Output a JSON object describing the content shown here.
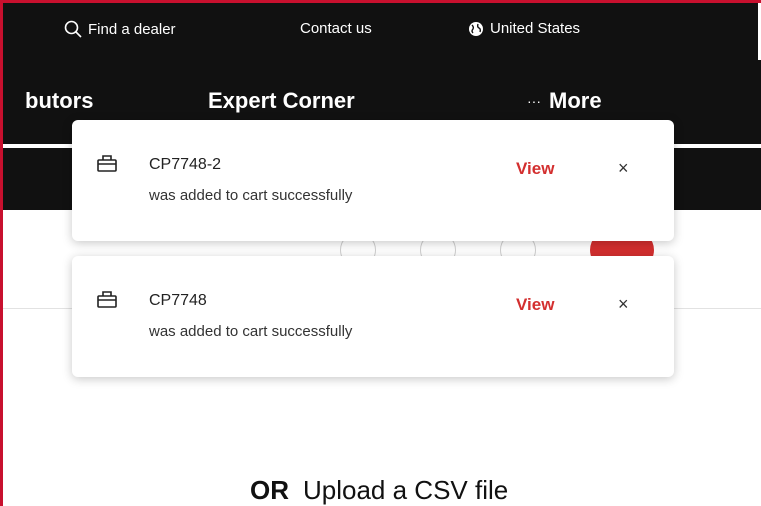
{
  "header": {
    "utility_links": {
      "find_dealer": "Find a dealer",
      "contact_us": "Contact us",
      "region": "United States"
    },
    "nav": {
      "distributors_partial": "butors",
      "expert_corner": "Expert Corner",
      "more_prefix": "···",
      "more": "More"
    }
  },
  "toasts": [
    {
      "sku": "CP7748-2",
      "message": "was added to cart successfully",
      "action": "View",
      "close": "×"
    },
    {
      "sku": "CP7748",
      "message": "was added to cart successfully",
      "action": "View",
      "close": "×"
    }
  ],
  "main": {
    "upload_or": "OR",
    "upload_label": "Upload a CSV file"
  },
  "colors": {
    "accent": "#d32f2f",
    "header_bg": "#111111",
    "frame": "#c8102e"
  },
  "icons": [
    "search-icon",
    "globe-icon",
    "bag-icon",
    "close-icon",
    "account-icon",
    "compare-icon",
    "settings-icon",
    "cart-icon"
  ]
}
